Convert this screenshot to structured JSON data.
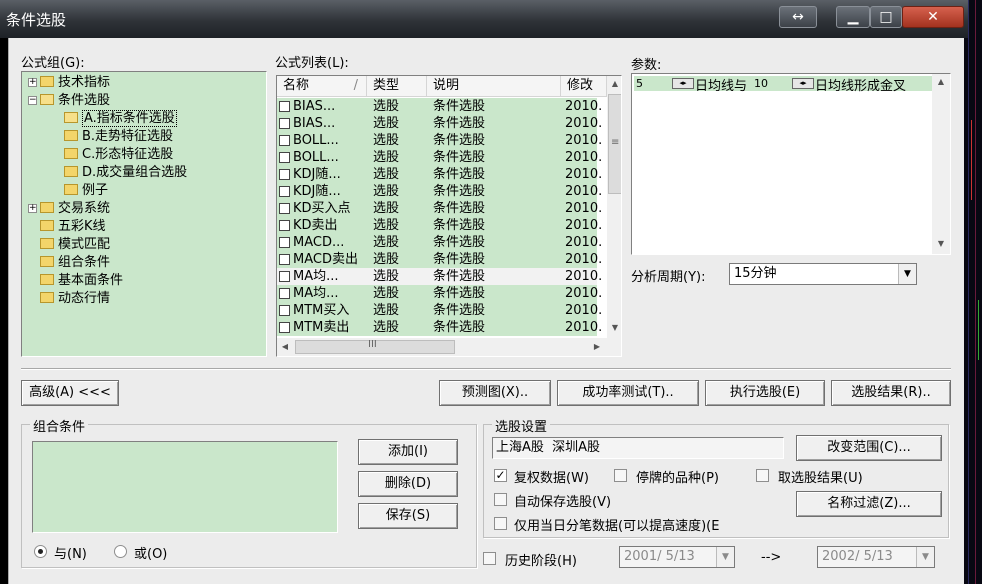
{
  "window": {
    "title": "条件选股",
    "btn_expand": "↔",
    "btn_min": "▁",
    "btn_max": "□",
    "btn_close": "✕"
  },
  "formula_group": {
    "label": "公式组(G):",
    "tree": [
      {
        "label": "技术指标",
        "expander": "+"
      },
      {
        "label": "条件选股",
        "expander": "−"
      },
      {
        "label": "A.指标条件选股"
      },
      {
        "label": "B.走势特征选股"
      },
      {
        "label": "C.形态特征选股"
      },
      {
        "label": "D.成交量组合选股"
      },
      {
        "label": "例子"
      },
      {
        "label": "交易系统",
        "expander": "+"
      },
      {
        "label": "五彩K线"
      },
      {
        "label": "模式匹配"
      },
      {
        "label": "组合条件"
      },
      {
        "label": "基本面条件"
      },
      {
        "label": "动态行情"
      }
    ]
  },
  "formula_list": {
    "label": "公式列表(L):",
    "columns": [
      "名称",
      "类型",
      "说明",
      "修改"
    ],
    "sort_mark": "/",
    "rows": [
      [
        "BIAS...",
        "选股",
        "条件选股",
        "2010."
      ],
      [
        "BIAS...",
        "选股",
        "条件选股",
        "2010."
      ],
      [
        "BOLL...",
        "选股",
        "条件选股",
        "2010."
      ],
      [
        "BOLL...",
        "选股",
        "条件选股",
        "2010."
      ],
      [
        "KDJ随...",
        "选股",
        "条件选股",
        "2010."
      ],
      [
        "KDJ随...",
        "选股",
        "条件选股",
        "2010."
      ],
      [
        "KD买入点",
        "选股",
        "条件选股",
        "2010."
      ],
      [
        "KD卖出",
        "选股",
        "条件选股",
        "2010."
      ],
      [
        "MACD...",
        "选股",
        "条件选股",
        "2010."
      ],
      [
        "MACD卖出",
        "选股",
        "条件选股",
        "2010."
      ],
      [
        "MA均...",
        "选股",
        "条件选股",
        "2010."
      ],
      [
        "MA均...",
        "选股",
        "条件选股",
        "2010."
      ],
      [
        "MTM买入",
        "选股",
        "条件选股",
        "2010."
      ],
      [
        "MTM卖出",
        "选股",
        "条件选股",
        "2010."
      ]
    ],
    "hscroll_grip": "III",
    "vscroll_grip": "≡"
  },
  "params": {
    "label": "参数:",
    "value1": "5",
    "text1": "日均线与",
    "value2": "10",
    "text2": "日均线形成金叉"
  },
  "period": {
    "label": "分析周期(Y):",
    "value": "15分钟"
  },
  "buttons": {
    "advanced": "高级(A) <<<",
    "preview": "预测图(X)..",
    "success_test": "成功率测试(T)..",
    "run": "执行选股(E)",
    "results": "选股结果(R)..",
    "add": "添加(I)",
    "delete": "删除(D)",
    "save": "保存(S)",
    "change_range": "改变范围(C)...",
    "name_filter": "名称过滤(Z)..."
  },
  "combo_conditions": {
    "title": "组合条件",
    "radio_and": "与(N)",
    "radio_or": "或(O)"
  },
  "selection_settings": {
    "title": "选股设置",
    "range": "上海A股  深圳A股",
    "opt_restore": "复权数据(W)",
    "opt_suspended": "停牌的品种(P)",
    "opt_take_result": "取选股结果(U)",
    "opt_autosave": "自动保存选股(V)",
    "opt_tick_only": "仅用当日分笔数据(可以提高速度)(E"
  },
  "history": {
    "label": "历史阶段(H)",
    "from": "2001/ 5/13",
    "arrow": "-->",
    "to": "2002/ 5/13"
  },
  "colors": {
    "panel_green": "#cae7cb",
    "dialog_bg": "#ececec"
  }
}
